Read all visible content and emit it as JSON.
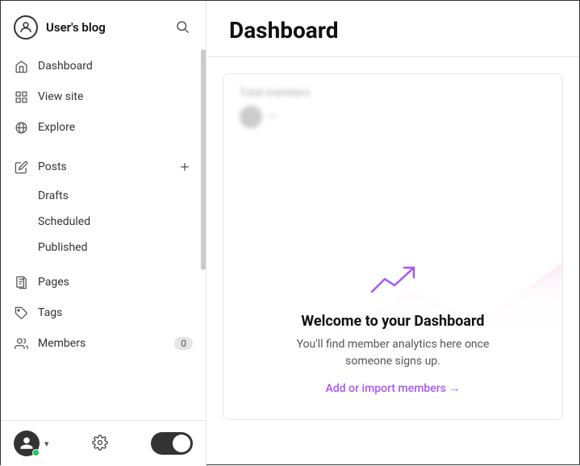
{
  "sidebar": {
    "site_name": "User's blog",
    "nav": [
      {
        "id": "dashboard",
        "label": "Dashboard",
        "icon": "home"
      },
      {
        "id": "view-site",
        "label": "View site",
        "icon": "grid"
      },
      {
        "id": "explore",
        "label": "Explore",
        "icon": "globe"
      }
    ],
    "posts_group": {
      "label": "Posts",
      "sub_items": [
        "Drafts",
        "Scheduled",
        "Published"
      ]
    },
    "nav2": [
      {
        "id": "pages",
        "label": "Pages",
        "icon": "file"
      },
      {
        "id": "tags",
        "label": "Tags",
        "icon": "tag"
      },
      {
        "id": "members",
        "label": "Members",
        "icon": "users",
        "badge": "0"
      }
    ],
    "footer": {
      "settings_label": "Settings",
      "toggle_state": "dark"
    }
  },
  "main": {
    "title": "Dashboard",
    "card": {
      "members_label": "Total members",
      "welcome_title": "Welcome to your Dashboard",
      "welcome_desc": "You'll find member analytics here once someone signs up.",
      "welcome_link": "Add or import members →"
    }
  }
}
